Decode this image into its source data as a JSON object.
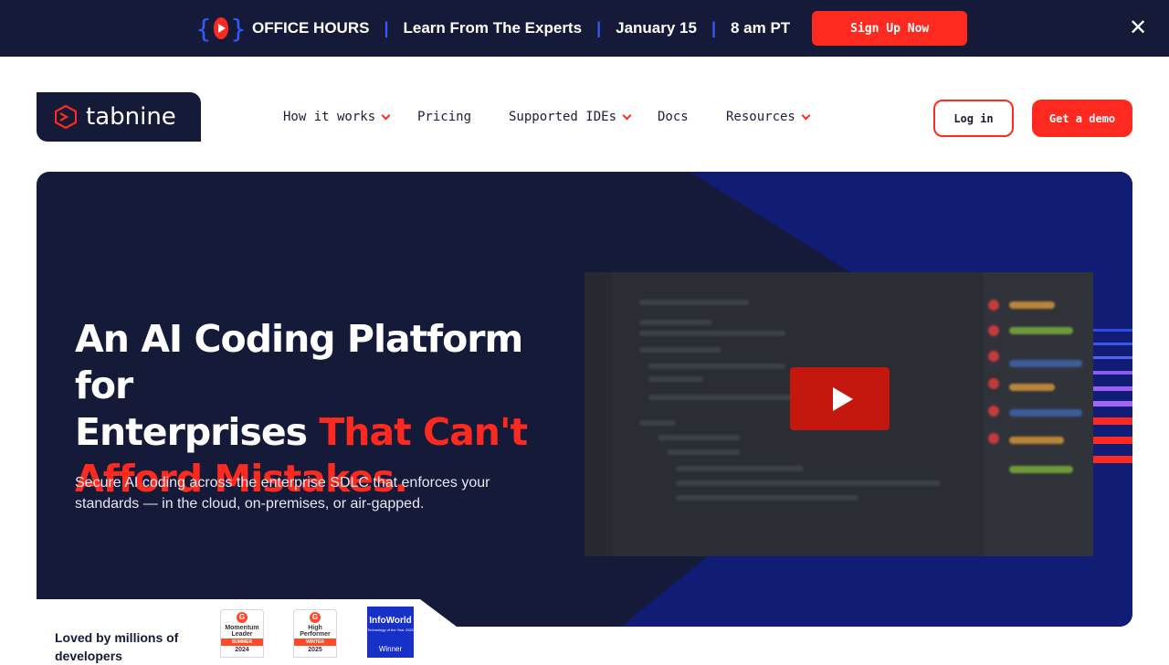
{
  "banner": {
    "event": "OFFICE HOURS",
    "tagline": "Learn From The Experts",
    "date": "January 15",
    "time": "8 am PT",
    "cta": "Sign Up Now",
    "close_icon": "close-icon"
  },
  "logo": {
    "text": "tabnine"
  },
  "nav": {
    "items": [
      {
        "label": "How it works",
        "dropdown": true
      },
      {
        "label": "Pricing",
        "dropdown": false
      },
      {
        "label": "Supported IDEs",
        "dropdown": true
      },
      {
        "label": "Docs",
        "dropdown": false
      },
      {
        "label": "Resources",
        "dropdown": true
      }
    ],
    "login": "Log in",
    "demo": "Get a demo"
  },
  "hero": {
    "title_line1": "An AI Coding Platform for",
    "title_line2_plain": "Enterprises ",
    "title_line2_accent": "That Can't",
    "title_line3_accent": "Afford Mistakes.",
    "subtitle": "Secure AI coding across the enterprise SDLC that enforces your standards — in the cloud, on-premises, or air-gapped.",
    "video_icon": "play-icon"
  },
  "social": {
    "loved": "Loved by millions of developers",
    "badges": [
      {
        "title": "Momentum Leader",
        "ribbon": "SUMMER",
        "year": "2024"
      },
      {
        "title": "High Performer",
        "ribbon": "WINTER",
        "year": "2025"
      }
    ],
    "infoworld": {
      "title": "InfoWorld",
      "sub": "Technology of the Year 2025",
      "label": "Winner"
    }
  },
  "colors": {
    "navy": "#141a38",
    "accent": "#ff2a1f",
    "blue": "#1730c8"
  }
}
